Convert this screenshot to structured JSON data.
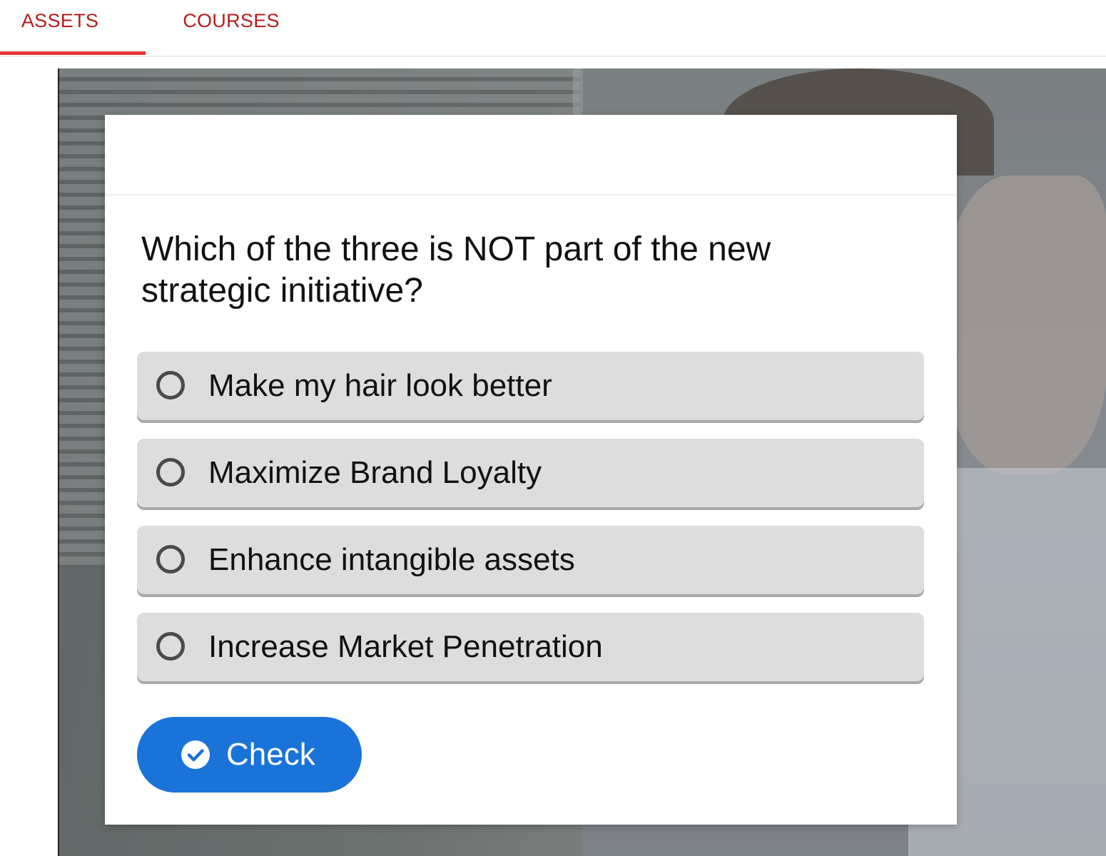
{
  "tabs": [
    {
      "label": "ASSETS",
      "active": true
    },
    {
      "label": "COURSES",
      "active": false
    }
  ],
  "quiz": {
    "question": "Which of the three is NOT part of the new strategic initiative?",
    "options": [
      {
        "label": "Make my hair look better",
        "selected": false
      },
      {
        "label": "Maximize Brand Loyalty",
        "selected": false
      },
      {
        "label": "Enhance intangible assets",
        "selected": false
      },
      {
        "label": "Increase Market Penetration",
        "selected": false
      }
    ],
    "check_button": {
      "label": "Check",
      "icon": "check-circle-icon"
    }
  },
  "colors": {
    "tab_text": "#b71c1c",
    "tab_indicator": "#e53935",
    "option_background": "#dddddd",
    "check_button": "#1a73d9"
  }
}
